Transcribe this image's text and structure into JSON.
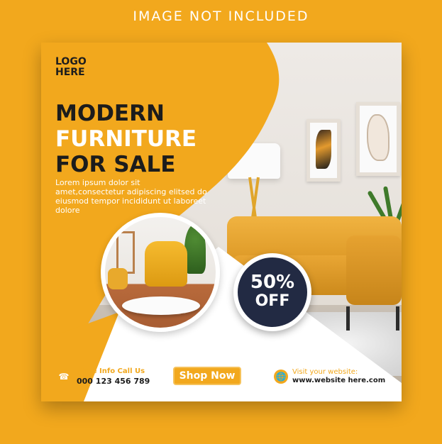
{
  "top_note": "IMAGE NOT INCLUDED",
  "logo": {
    "line1": "LOGO",
    "line2": "HERE"
  },
  "headline": {
    "line1": "MODERN",
    "line2": "FURNITURE",
    "line3": "FOR SALE"
  },
  "description": "Lorem ipsum dolor sit amet,consectetur adipiscing elitsed do eiusmod tempor incididunt ut laboreet dolore",
  "discount": {
    "percent": "50%",
    "off": "OFF"
  },
  "footer": {
    "phone_label": "More Info Call Us",
    "phone_number": "000 123 456 789",
    "shop_button": "Shop Now",
    "website_label": "Visit your website:",
    "website_url": "www.website here.com",
    "phone_icon": "phone-icon",
    "globe_icon": "globe-icon"
  },
  "colors": {
    "background": "#f2a81d",
    "accent": "#f2a81d",
    "dark_badge": "#222a43",
    "text_dark": "#1c1c1c",
    "white": "#ffffff"
  }
}
